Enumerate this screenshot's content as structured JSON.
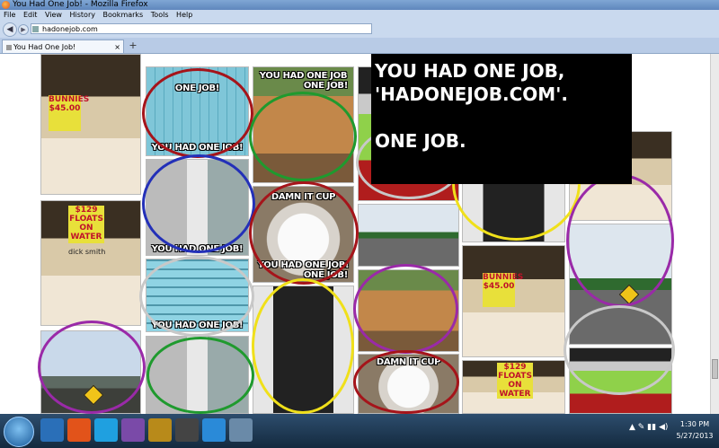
{
  "window": {
    "title": "You Had One Job! - Mozilla Firefox"
  },
  "menu": [
    "File",
    "Edit",
    "View",
    "History",
    "Bookmarks",
    "Tools",
    "Help"
  ],
  "nav": {
    "url": "hadonejob.com"
  },
  "tab": {
    "label": "You Had One Job!",
    "close": "×",
    "new": "+"
  },
  "captions": {
    "one_job": "ONE JOB!",
    "you_had_one_job": "YOU HAD ONE JOB!",
    "you_had_one_job_line1": "YOU HAD ONE JOB",
    "one_job_line2": "ONE JOB!",
    "damn_it_cup": "DAMN IT CUP",
    "damn_it_cup_2": "DAMN IT CUP",
    "you_had_one_job_2": "YOU HAD ONE JOB!",
    "you_had_one_job_3": "YOU HAD ONE JOB!",
    "you_had_one_job_4": "YOU HAD ONE JOB!",
    "you_had_one_job_5": "YOU HAD ONE JOB!",
    "you_had_one_job_6": "YOU HAD ONE",
    "one_job_6": "ONE JOB!"
  },
  "prices": {
    "bunnies": "BUNNIES $45.00",
    "floats": "$129 FLOATS ON WATER",
    "dick_smith": "dick smith",
    "bunnies2": "BUNNIES $45.00",
    "floats2": "$129 FLOATS ON WATER"
  },
  "meme": {
    "line1": "YOU HAD ONE JOB,",
    "line2": "'HADONEJOB.COM'.",
    "line3": "",
    "line4": "ONE JOB."
  },
  "taskbar": {
    "time": "1:30 PM",
    "date": "5/27/2013"
  },
  "colors": {
    "ring_red": "#a5141a",
    "ring_blue": "#2330b8",
    "ring_green": "#1f9a2e",
    "ring_yellow": "#f0e01a",
    "ring_purple": "#9a2aa8",
    "ring_gray": "#c8c8c8"
  }
}
